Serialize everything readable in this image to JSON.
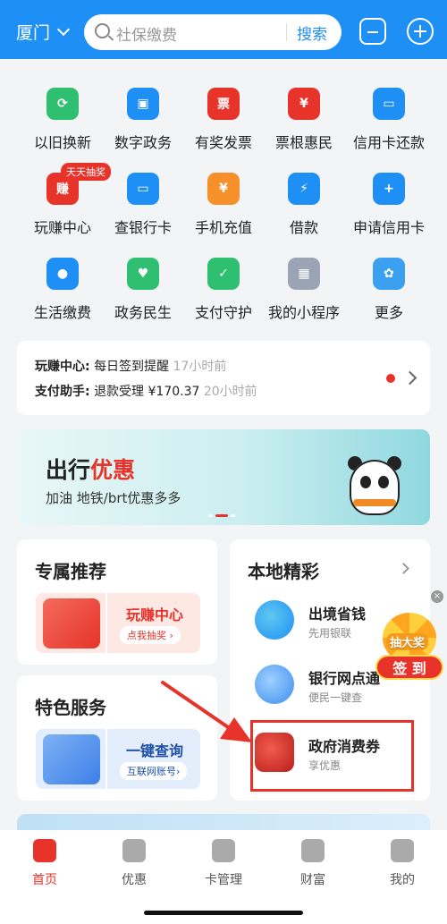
{
  "header": {
    "city": "厦门",
    "search_placeholder": "社保缴费",
    "search_button": "搜索"
  },
  "grid": [
    {
      "label": "以旧换新",
      "color": "#2fbf71",
      "glyph": "⟳"
    },
    {
      "label": "数字政务",
      "color": "#1e8ff5",
      "glyph": "▣"
    },
    {
      "label": "有奖发票",
      "color": "#e8332a",
      "glyph": "票"
    },
    {
      "label": "票根惠民",
      "color": "#e8332a",
      "glyph": "¥"
    },
    {
      "label": "信用卡还款",
      "color": "#1e8ff5",
      "glyph": "▭"
    },
    {
      "label": "玩赚中心",
      "color": "#e8332a",
      "glyph": "赚"
    },
    {
      "label": "查银行卡",
      "color": "#1e8ff5",
      "glyph": "▭"
    },
    {
      "label": "手机充值",
      "color": "#f5902a",
      "glyph": "¥"
    },
    {
      "label": "借款",
      "color": "#1e8ff5",
      "glyph": "⚡"
    },
    {
      "label": "申请信用卡",
      "color": "#1e8ff5",
      "glyph": "+"
    },
    {
      "label": "生活缴费",
      "color": "#1e8ff5",
      "glyph": "●"
    },
    {
      "label": "政务民生",
      "color": "#2fbf71",
      "glyph": "♥"
    },
    {
      "label": "支付守护",
      "color": "#2fbf71",
      "glyph": "✓"
    },
    {
      "label": "我的小程序",
      "color": "#9aa4b5",
      "glyph": "▦"
    },
    {
      "label": "更多",
      "color": "#3ca0f0",
      "glyph": "✿"
    }
  ],
  "grid_badge": "天天抽奖",
  "notice": {
    "row1_label": "玩赚中心:",
    "row1_text": "每日签到提醒",
    "row1_time": "17小时前",
    "row2_label": "支付助手:",
    "row2_text": "退款受理 ¥170.37",
    "row2_time": "20小时前"
  },
  "banner": {
    "title_a": "出行",
    "title_b": "优惠",
    "subtitle": "加油 地铁/brt优惠多多"
  },
  "exclusive": {
    "title": "专属推荐",
    "item_title": "玩赚中心",
    "item_sub": "点我抽奖 ›"
  },
  "special": {
    "title": "特色服务",
    "item_title": "一键查询",
    "item_sub": "互联网账号›"
  },
  "local": {
    "title": "本地精彩",
    "items": [
      {
        "name": "出境省钱",
        "desc": "先用银联"
      },
      {
        "name": "银行网点通",
        "desc": "便民一键查"
      },
      {
        "name": "政府消费券",
        "desc": "享优惠"
      }
    ]
  },
  "float": {
    "lottery": "抽大奖",
    "sign": "签 到"
  },
  "tabs": [
    {
      "label": "首页",
      "active": true
    },
    {
      "label": "优惠",
      "active": false
    },
    {
      "label": "卡管理",
      "active": false
    },
    {
      "label": "财富",
      "active": false
    },
    {
      "label": "我的",
      "active": false
    }
  ]
}
